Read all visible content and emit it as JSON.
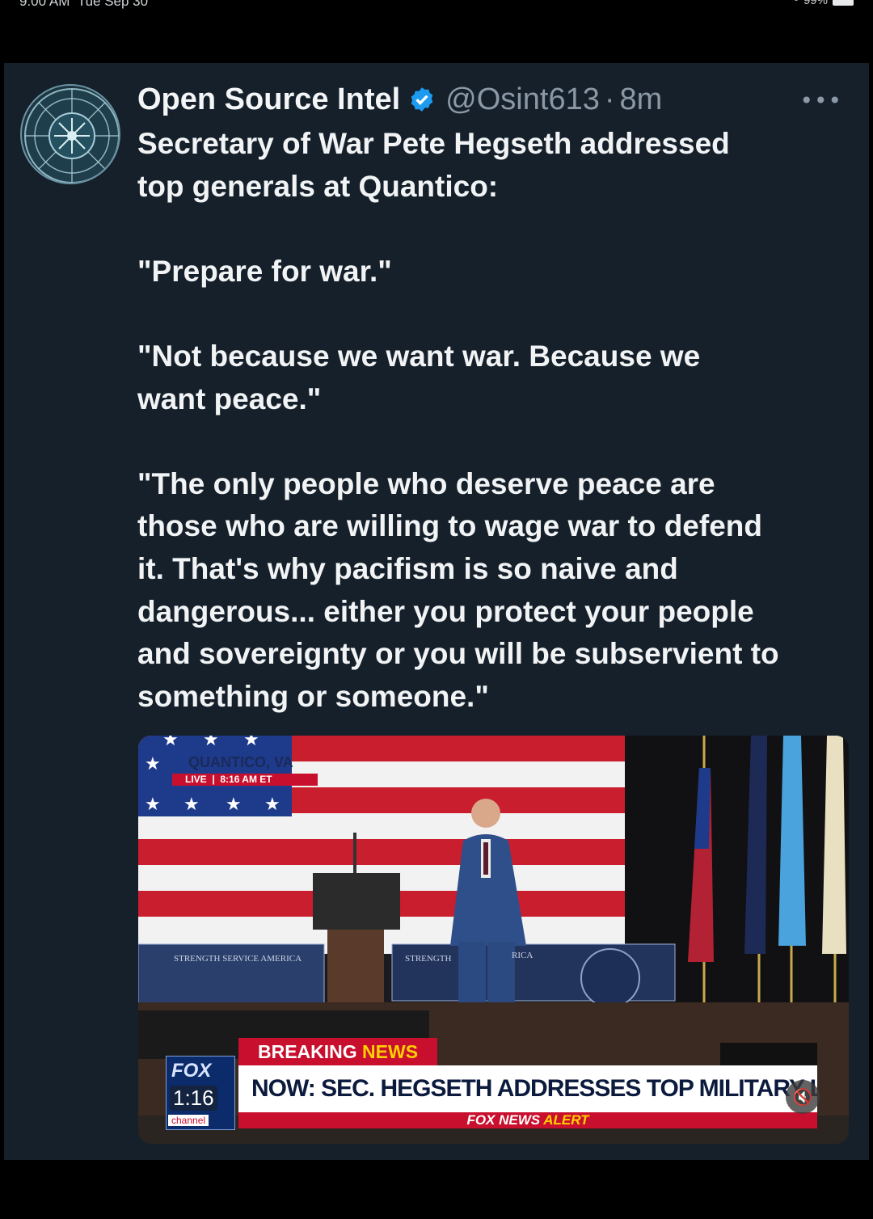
{
  "status_bar": {
    "time": "9:00 AM",
    "date": "Tue Sep 30",
    "dots": "•••",
    "battery": "99%"
  },
  "tweet": {
    "author_name": "Open Source Intel",
    "handle": "@Osint613",
    "separator": "·",
    "time_ago": "8m",
    "more": "•••",
    "lines": [
      "Secretary of War Pete Hegseth addressed",
      "top generals at Quantico:",
      "",
      "\"Prepare for war.\"",
      "",
      "\"Not because we want war. Because we",
      "want peace.\"",
      "",
      "\"The only people who deserve peace are",
      "those who are willing to wage war to defend",
      "it. That's why pacifism is so naive and",
      "dangerous... either you protect your people",
      "and sovereignty or you will be subservient to",
      "something or someone.\""
    ]
  },
  "media": {
    "location": "QUANTICO, VA",
    "live_label": "LIVE",
    "live_time": "8:16 AM ET",
    "podium_left": "STRENGTH  SERVICE  AMERICA",
    "podium_mid": "STRENGTH",
    "podium_right": "RICA",
    "breaking_word": "BREAKING",
    "news_word": "NEWS",
    "headline": "NOW: SEC. HEGSETH ADDRESSES TOP MILITARY LEADERS",
    "alert_fox": "FOX NEWS",
    "alert_word": "ALERT",
    "logo_text": "FOX",
    "duration": "1:16",
    "channel_label": "channel",
    "mute_icon": "🔇"
  },
  "colors": {
    "panel_bg": "#15202b",
    "verified_blue": "#1d9bf0",
    "fox_red": "#c8102e"
  }
}
